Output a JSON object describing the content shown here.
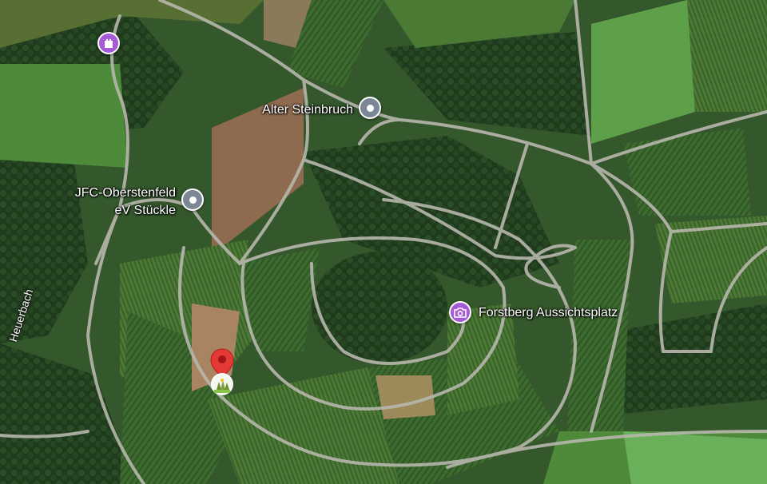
{
  "map": {
    "type": "satellite",
    "places": [
      {
        "name": "Alter Steinbruch",
        "icon": "location-pin-icon",
        "color": "#7b8794"
      },
      {
        "name_line1": "JFC-Oberstenfeld",
        "name_line2": "eV Stückle",
        "icon": "location-pin-icon",
        "color": "#7b8794"
      },
      {
        "name": "Forstberg Aussichtsplatz",
        "icon": "camera-icon",
        "color": "#a55bd8"
      },
      {
        "name": "",
        "icon": "castle-icon",
        "color": "#a55bd8"
      }
    ],
    "roads": [
      {
        "name": "Heuerbach"
      }
    ],
    "selected_marker": {
      "icon": "red-map-marker-icon",
      "color": "#e53935",
      "badge_icon": "vineyard-icon"
    }
  }
}
